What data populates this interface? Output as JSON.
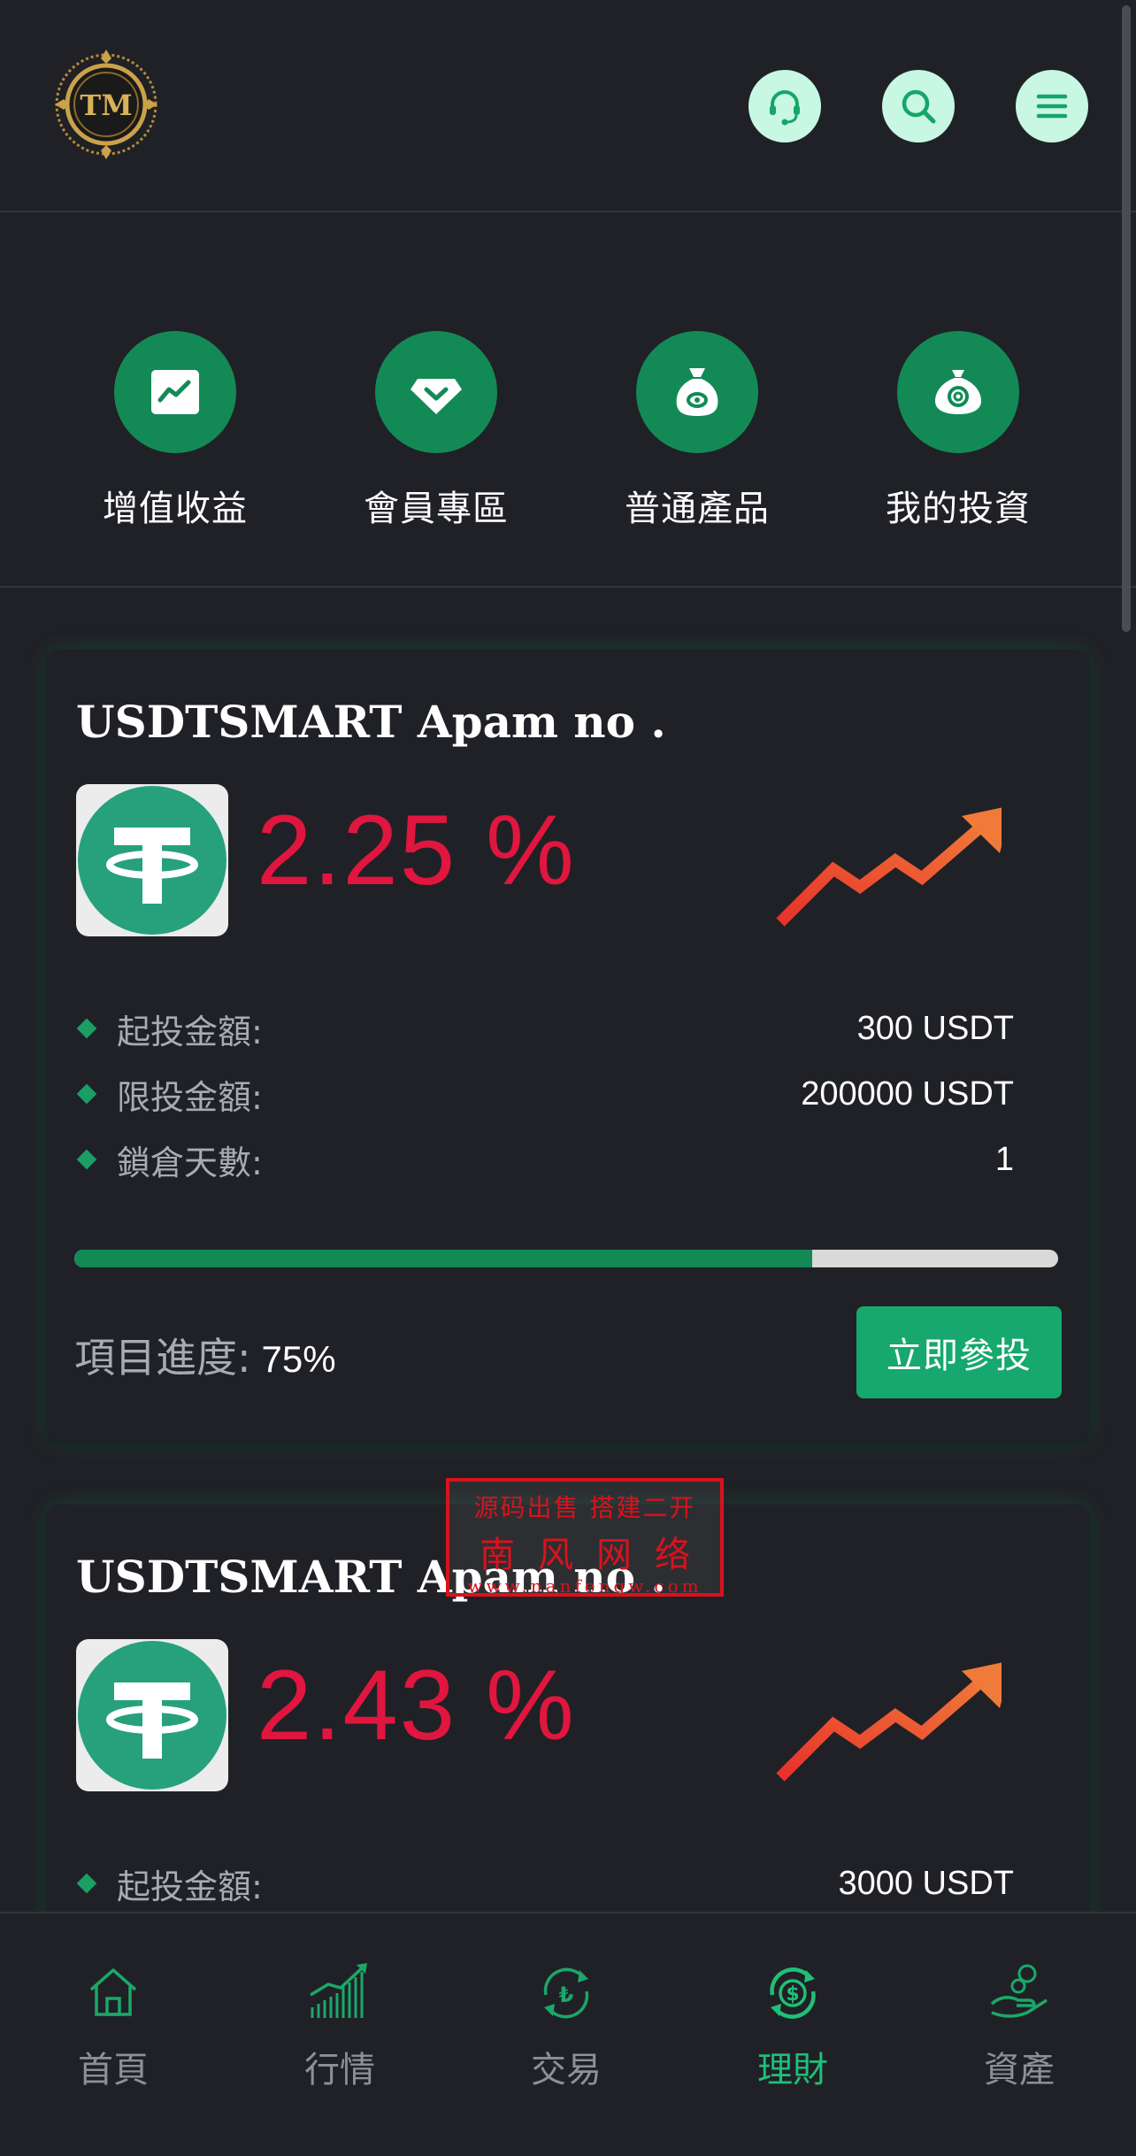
{
  "header": {
    "logo_text": "TM",
    "buttons": [
      {
        "name": "customer-service",
        "icon": "headset-icon"
      },
      {
        "name": "search",
        "icon": "search-icon"
      },
      {
        "name": "menu",
        "icon": "menu-icon"
      }
    ]
  },
  "quick_nav": [
    {
      "label": "增值收益",
      "icon": "chart-line-icon"
    },
    {
      "label": "會員專區",
      "icon": "diamond-icon"
    },
    {
      "label": "普通產品",
      "icon": "money-bag-icon"
    },
    {
      "label": "我的投資",
      "icon": "coin-bag-icon"
    }
  ],
  "products": [
    {
      "title": "USDTSMART Apam no .",
      "rate": "2.25 %",
      "min_label": "起投金額:",
      "min_value": "300 USDT",
      "max_label": "限投金額:",
      "max_value": "200000 USDT",
      "lock_label": "鎖倉天數:",
      "lock_value": "1",
      "progress_label": "項目進度:",
      "progress_text": "75%",
      "progress": 0.75,
      "button": "立即參投"
    },
    {
      "title": "USDTSMART Apam no .",
      "rate": "2.43 %",
      "min_label": "起投金額:",
      "min_value": "3000 USDT"
    }
  ],
  "watermark": {
    "line1": "源码出售 搭建二开",
    "line2": "南风网络",
    "line3": "www.nanfengw.com"
  },
  "tabbar": [
    {
      "label": "首頁",
      "icon": "home-icon",
      "active": false
    },
    {
      "label": "行情",
      "icon": "bar-chart-icon",
      "active": false
    },
    {
      "label": "交易",
      "icon": "exchange-icon",
      "active": false
    },
    {
      "label": "理財",
      "icon": "finance-icon",
      "active": true
    },
    {
      "label": "資產",
      "icon": "assets-icon",
      "active": false
    }
  ],
  "colors": {
    "background": "#202126",
    "accent_green": "#138a56",
    "button_green": "#16a86c",
    "rate_red": "#e0163f",
    "active_tab": "#1fbf78"
  }
}
